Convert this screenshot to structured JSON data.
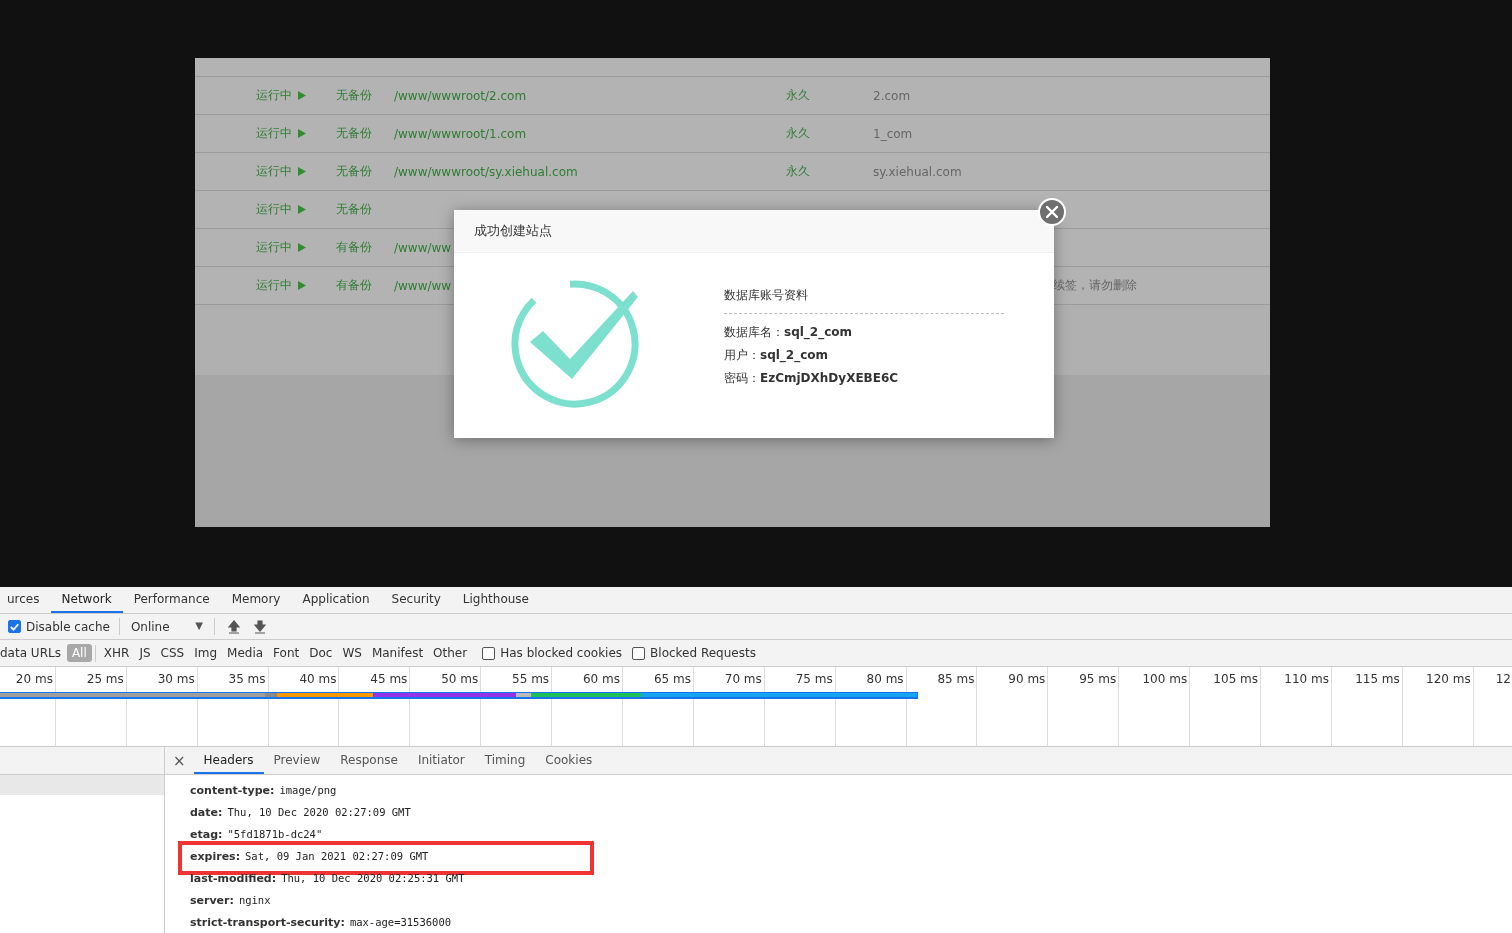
{
  "site_table": {
    "rows": [
      {
        "status": "运行中",
        "backup": "无备份",
        "path": "/www/wwwroot/2.com",
        "expiry": "永久",
        "note": "2.com"
      },
      {
        "status": "运行中",
        "backup": "无备份",
        "path": "/www/wwwroot/1.com",
        "expiry": "永久",
        "note": "1_com"
      },
      {
        "status": "运行中",
        "backup": "无备份",
        "path": "/www/wwwroot/sy.xiehual.com",
        "expiry": "永久",
        "note": "sy.xiehual.com"
      },
      {
        "status": "运行中",
        "backup": "无备份"
      },
      {
        "status": "运行中",
        "backup": "有备份",
        "path": "/www/ww"
      },
      {
        "status": "运行中",
        "backup": "有备份",
        "path": "/www/ww",
        "note": "续签，请勿删除"
      }
    ]
  },
  "dialog": {
    "title": "成功创建站点",
    "section_title": "数据库账号资料",
    "fields": [
      {
        "label": "数据库名：",
        "value": "sql_2_com"
      },
      {
        "label": "用户：",
        "value": "sql_2_com"
      },
      {
        "label": "密码：",
        "value": "EzCmjDXhDyXEBE6C"
      }
    ]
  },
  "devtools": {
    "tabs": [
      {
        "label": "urces",
        "selected": false
      },
      {
        "label": "Network",
        "selected": true
      },
      {
        "label": "Performance",
        "selected": false
      },
      {
        "label": "Memory",
        "selected": false
      },
      {
        "label": "Application",
        "selected": false
      },
      {
        "label": "Security",
        "selected": false
      },
      {
        "label": "Lighthouse",
        "selected": false
      }
    ],
    "disable_cache": {
      "label": "Disable cache",
      "checked": true
    },
    "throttling": {
      "value": "Online",
      "caret": "▼"
    },
    "filter_label": "data URLs",
    "filters": [
      {
        "label": "All",
        "selected": true
      },
      {
        "label": "XHR",
        "selected": false
      },
      {
        "label": "JS",
        "selected": false
      },
      {
        "label": "CSS",
        "selected": false
      },
      {
        "label": "Img",
        "selected": false
      },
      {
        "label": "Media",
        "selected": false
      },
      {
        "label": "Font",
        "selected": false
      },
      {
        "label": "Doc",
        "selected": false
      },
      {
        "label": "WS",
        "selected": false
      },
      {
        "label": "Manifest",
        "selected": false
      },
      {
        "label": "Other",
        "selected": false
      }
    ],
    "checkboxes": [
      {
        "label": "Has blocked cookies",
        "checked": false
      },
      {
        "label": "Blocked Requests",
        "checked": false
      }
    ],
    "timeline_ticks": [
      "20 ms",
      "25 ms",
      "30 ms",
      "35 ms",
      "40 ms",
      "45 ms",
      "50 ms",
      "55 ms",
      "60 ms",
      "65 ms",
      "70 ms",
      "75 ms",
      "80 ms",
      "85 ms",
      "90 ms",
      "95 ms",
      "100 ms",
      "105 ms",
      "110 ms",
      "115 ms",
      "120 ms",
      "12"
    ],
    "detail_close": "×",
    "detail_tabs": [
      {
        "label": "Headers",
        "selected": true
      },
      {
        "label": "Preview",
        "selected": false
      },
      {
        "label": "Response",
        "selected": false
      },
      {
        "label": "Initiator",
        "selected": false
      },
      {
        "label": "Timing",
        "selected": false
      },
      {
        "label": "Cookies",
        "selected": false
      }
    ],
    "headers": [
      {
        "name": "content-type:",
        "value": "image/png"
      },
      {
        "name": "date:",
        "value": "Thu, 10 Dec 2020 02:27:09 GMT"
      },
      {
        "name": "etag:",
        "value": "\"5fd1871b-dc24\""
      },
      {
        "name": "expires:",
        "value": "Sat, 09 Jan 2021 02:27:09 GMT",
        "highlighted": true
      },
      {
        "name": "last-modified:",
        "value": "Thu, 10 Dec 2020 02:25:31 GMT"
      },
      {
        "name": "server:",
        "value": "nginx"
      },
      {
        "name": "strict-transport-security:",
        "value": "max-age=31536000"
      }
    ]
  }
}
